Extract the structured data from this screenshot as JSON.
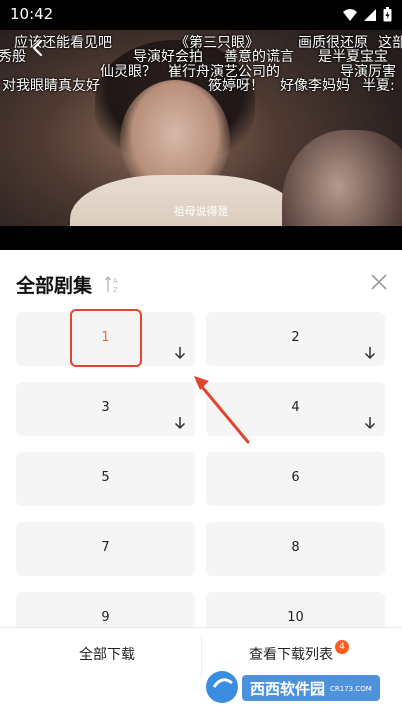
{
  "status": {
    "time": "10:42"
  },
  "video": {
    "subtitle": "祖母说得是",
    "danmaku": [
      {
        "text": "应该还能看见吧"
      },
      {
        "text": "《第三只眼》"
      },
      {
        "text": "画质很还原"
      },
      {
        "text": "这部"
      },
      {
        "text": "秀般"
      },
      {
        "text": "导演好会拍"
      },
      {
        "text": "善意的谎言"
      },
      {
        "text": "是半夏宝宝"
      },
      {
        "text": "仙灵眼？"
      },
      {
        "text": "崔行舟演艺公司的"
      },
      {
        "text": "导演厉害"
      },
      {
        "text": "对我眼睛真友好"
      },
      {
        "text": "筱婷呀！"
      },
      {
        "text": "好像李妈妈"
      },
      {
        "text": "半夏:"
      }
    ]
  },
  "sheet": {
    "title": "全部剧集",
    "episodes": [
      {
        "label": "1",
        "active": true
      },
      {
        "label": "2"
      },
      {
        "label": "3"
      },
      {
        "label": "4"
      },
      {
        "label": "5"
      },
      {
        "label": "6"
      },
      {
        "label": "7"
      },
      {
        "label": "8"
      },
      {
        "label": "9"
      },
      {
        "label": "10"
      }
    ]
  },
  "bottom": {
    "download_all": "全部下载",
    "view_list": "查看下载列表",
    "badge": "4"
  },
  "colors": {
    "accent": "#ef6c2e",
    "annotation": "#e0452e",
    "badge": "#ff5a1f"
  },
  "watermark": {
    "text": "西西软件园",
    "sub": "CR173.COM"
  }
}
